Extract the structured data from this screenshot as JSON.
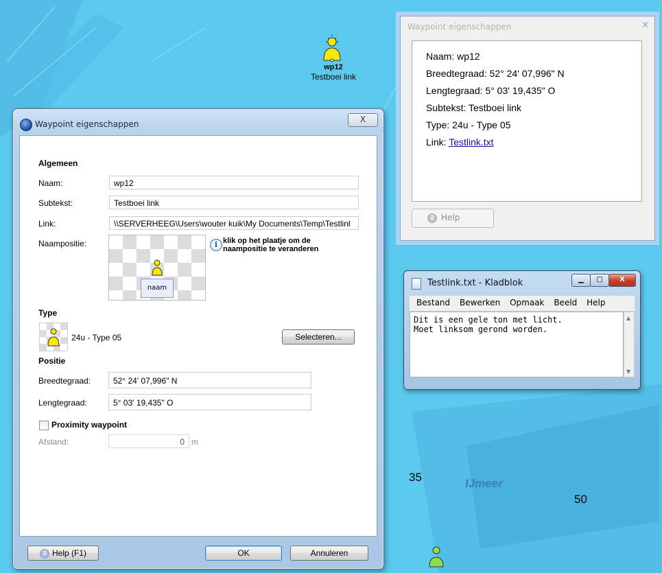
{
  "map": {
    "waypoint_name": "wp12",
    "waypoint_subtext": "Testboei link",
    "depth_35": "35",
    "depth_50": "50",
    "water_name": "IJmeer"
  },
  "dialog": {
    "title": "Waypoint eigenschappen",
    "close_label": "X",
    "algemeen_header": "Algemeen",
    "naam_label": "Naam:",
    "naam_value": "wp12",
    "subtekst_label": "Subtekst:",
    "subtekst_value": "Testboei link",
    "link_label": "Link:",
    "link_value": "\\\\SERVERHEEG\\Users\\wouter kuik\\My Documents\\Temp\\Testlinl",
    "naampositie_label": "Naampositie:",
    "naam_box": "naam",
    "hint_line1": "klik op het plaatje om de",
    "hint_line2": "naampositie te veranderen",
    "type_header": "Type",
    "type_value": "24u - Type 05",
    "select_button": "Selecteren...",
    "positie_header": "Positie",
    "breedte_label": "Breedtegraad:",
    "breedte_value": "52° 24' 07,996\" N",
    "lengte_label": "Lengtegraad:",
    "lengte_value": "5° 03' 19,435\" O",
    "proximity_label": "Proximity waypoint",
    "afstand_label": "Afstand:",
    "afstand_value": "0",
    "afstand_unit": "m",
    "help_button": "Help (F1)",
    "ok_button": "OK",
    "cancel_button": "Annuleren"
  },
  "prop_window": {
    "title": "Waypoint eigenschappen",
    "close": "×",
    "naam": "Naam: wp12",
    "breedte": "Breedtegraad: 52° 24' 07,996\" N",
    "lengte": "Lengtegraad: 5° 03' 19,435\" O",
    "subtekst": "Subtekst: Testboei link",
    "type": "Type: 24u - Type 05",
    "link_prefix": "Link: ",
    "link_text": "Testlink.txt",
    "help_button": "Help"
  },
  "notepad": {
    "title": "Testlink.txt - Kladblok",
    "menu": [
      "Bestand",
      "Bewerken",
      "Opmaak",
      "Beeld",
      "Help"
    ],
    "content": "Dit is een gele ton met licht.\nMoet linksom gerond worden."
  },
  "colors": {
    "water": "#5cc9ef",
    "buoy": "#f7e800",
    "link": "#1a0dab"
  }
}
